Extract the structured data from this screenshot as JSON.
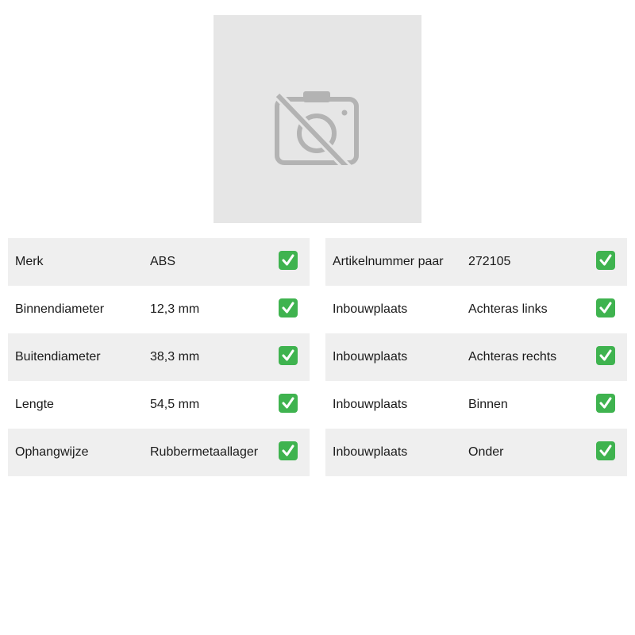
{
  "image": {
    "icon": "no-photo-icon"
  },
  "colors": {
    "check": "#3fb34f",
    "row_shade": "#efefef",
    "placeholder_bg": "#e6e6e6",
    "placeholder_icon": "#b3b3b3"
  },
  "specs_left": [
    {
      "label": "Merk",
      "value": "ABS"
    },
    {
      "label": "Binnendiameter",
      "value": "12,3 mm"
    },
    {
      "label": "Buitendiameter",
      "value": "38,3 mm"
    },
    {
      "label": "Lengte",
      "value": "54,5 mm"
    },
    {
      "label": "Ophangwijze",
      "value": "Rubbermetaallager"
    }
  ],
  "specs_right": [
    {
      "label": "Artikelnummer paar",
      "value": "272105"
    },
    {
      "label": "Inbouwplaats",
      "value": "Achteras links"
    },
    {
      "label": "Inbouwplaats",
      "value": "Achteras rechts"
    },
    {
      "label": "Inbouwplaats",
      "value": "Binnen"
    },
    {
      "label": "Inbouwplaats",
      "value": "Onder"
    }
  ]
}
